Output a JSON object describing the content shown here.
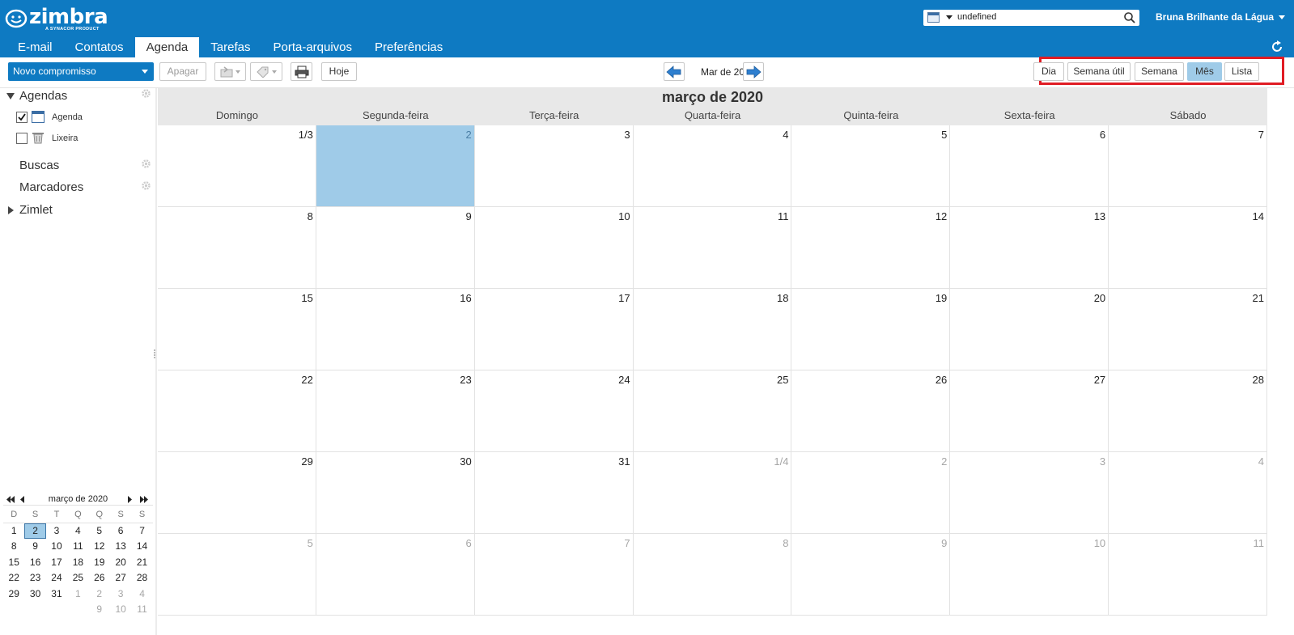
{
  "header": {
    "logo_text": "zimbra",
    "logo_sub": "A SYNACOR PRODUCT",
    "search": {
      "value": "undefined",
      "type_icon": "calendar-icon"
    },
    "user_name": "Bruna Brilhante da Lágua",
    "tabs": [
      {
        "label": "E-mail"
      },
      {
        "label": "Contatos"
      },
      {
        "label": "Agenda",
        "active": true
      },
      {
        "label": "Tarefas"
      },
      {
        "label": "Porta-arquivos"
      },
      {
        "label": "Preferências"
      }
    ]
  },
  "toolbar": {
    "new_appointment": "Novo compromisso",
    "delete": "Apagar",
    "today": "Hoje",
    "nav_label": "Mar de 2020",
    "views": [
      {
        "label": "Dia"
      },
      {
        "label": "Semana útil"
      },
      {
        "label": "Semana"
      },
      {
        "label": "Mês",
        "active": true
      },
      {
        "label": "Lista"
      }
    ]
  },
  "sidebar": {
    "agendas_header": "Agendas",
    "agendas": [
      {
        "label": "Agenda",
        "checked": true
      },
      {
        "label": "Lixeira",
        "checked": false
      }
    ],
    "searches": "Buscas",
    "tags": "Marcadores",
    "zimlet": "Zimlet"
  },
  "minical": {
    "title": "março de 2020",
    "dow": [
      "D",
      "S",
      "T",
      "Q",
      "Q",
      "S",
      "S"
    ],
    "weeks": [
      [
        "1",
        "2",
        "3",
        "4",
        "5",
        "6",
        "7"
      ],
      [
        "8",
        "9",
        "10",
        "11",
        "12",
        "13",
        "14"
      ],
      [
        "15",
        "16",
        "17",
        "18",
        "19",
        "20",
        "21"
      ],
      [
        "22",
        "23",
        "24",
        "25",
        "26",
        "27",
        "28"
      ],
      [
        "29",
        "30",
        "31",
        "1",
        "2",
        "3",
        "4"
      ],
      [
        "",
        "",
        "",
        "",
        "9",
        "10",
        "11"
      ]
    ],
    "selected": "2"
  },
  "month": {
    "title": "março de 2020",
    "dow": [
      "Domingo",
      "Segunda-feira",
      "Terça-feira",
      "Quarta-feira",
      "Quinta-feira",
      "Sexta-feira",
      "Sábado"
    ],
    "weeks": [
      [
        "1/3",
        "2",
        "3",
        "4",
        "5",
        "6",
        "7"
      ],
      [
        "8",
        "9",
        "10",
        "11",
        "12",
        "13",
        "14"
      ],
      [
        "15",
        "16",
        "17",
        "18",
        "19",
        "20",
        "21"
      ],
      [
        "22",
        "23",
        "24",
        "25",
        "26",
        "27",
        "28"
      ],
      [
        "29",
        "30",
        "31",
        "1/4",
        "2",
        "3",
        "4"
      ],
      [
        "5",
        "6",
        "7",
        "8",
        "9",
        "10",
        "11"
      ]
    ],
    "today": "2"
  },
  "colors": {
    "brand": "#0e7ac2",
    "today": "#9fcbe8",
    "highlight": "#e01c24"
  }
}
